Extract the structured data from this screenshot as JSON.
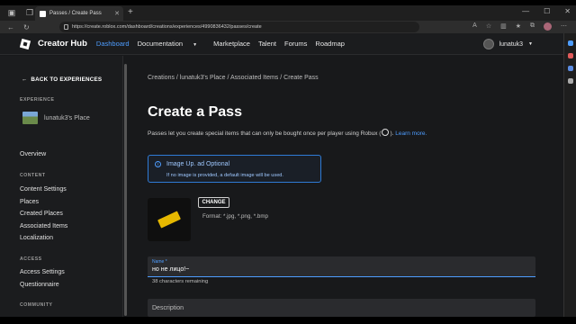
{
  "browser": {
    "tab_title": "Passes / Create Pass",
    "url": "https://create.roblox.com/dashboard/creations/experiences/4990836432/passes/create"
  },
  "header": {
    "brand": "Creator Hub",
    "menu": [
      "Dashboard",
      "Documentation",
      "Marketplace",
      "Talent",
      "Forums",
      "Roadmap"
    ],
    "username": "lunatuk3"
  },
  "sidebar": {
    "back": "BACK TO EXPERIENCES",
    "experience_section": "EXPERIENCE",
    "experience_name": "lunatuk3's Place",
    "overview": "Overview",
    "content_section": "CONTENT",
    "content_items": [
      "Content Settings",
      "Places",
      "Created Places",
      "Associated Items",
      "Localization"
    ],
    "access_section": "ACCESS",
    "access_items": [
      "Access Settings",
      "Questionnaire"
    ],
    "community_section": "COMMUNITY"
  },
  "main": {
    "breadcrumb": "Creations / lunatuk3's Place / Associated Items / Create Pass",
    "title": "Create a Pass",
    "description_pre": "Passes let you create special items that can only be bought once per player using Robux (",
    "description_post": ").",
    "learn_more": "Learn more.",
    "info_title": "Image Up. ad Optional",
    "info_text": "If no image is provided, a default image will be used.",
    "change_button": "CHANGE",
    "formats": "Format: *.jpg, *.png, *.bmp",
    "name_label": "Name *",
    "name_value": "но не лицо!~",
    "remaining": "38 characters remaining",
    "description_label": "Description"
  },
  "colors": {
    "accent": "#4e9dff",
    "background": "#18191b"
  }
}
